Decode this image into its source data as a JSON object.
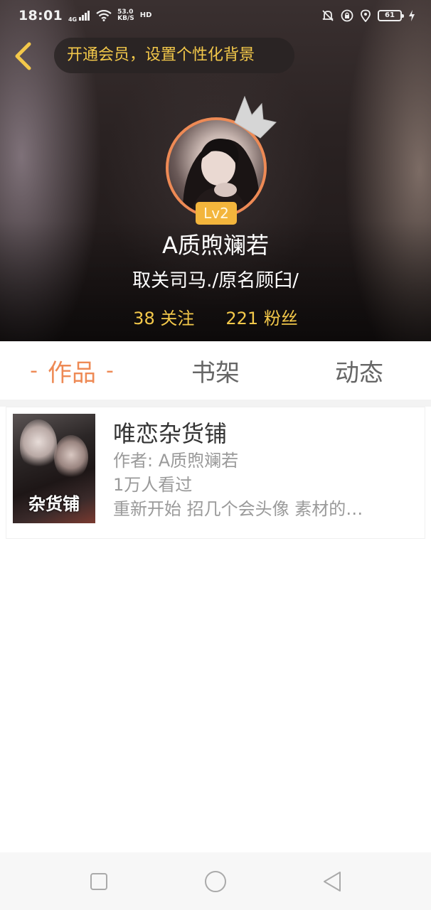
{
  "status_bar": {
    "time": "18:01",
    "network": "4G",
    "net_speed_value": "53.0",
    "net_speed_unit": "KB/S",
    "hd": "HD",
    "battery": "61"
  },
  "header": {
    "vip_banner": "开通会员，设置个性化背景",
    "level": "Lv2",
    "username": "A质煦斓若",
    "signature": "取关司马./原名顾臼/",
    "following_count": "38",
    "following_label": "关注",
    "followers_count": "221",
    "followers_label": "粉丝"
  },
  "tabs": [
    {
      "label": "作品",
      "active": true
    },
    {
      "label": "书架",
      "active": false
    },
    {
      "label": "动态",
      "active": false
    }
  ],
  "works": [
    {
      "title": "唯恋杂货铺",
      "author": "作者: A质煦斓若",
      "views": "1万人看过",
      "summary": "重新开始 招几个会头像 素材的…",
      "cover_text": "杂货铺"
    }
  ],
  "colors": {
    "accent": "#ee8a55",
    "gold": "#f3c84a",
    "level_badge": "#f3b53c"
  },
  "icons": [
    "back-chevron-icon",
    "crown-icon",
    "signal-icon",
    "wifi-icon",
    "mute-bell-icon",
    "lock-rotate-icon",
    "location-icon",
    "battery-icon",
    "charging-icon",
    "nav-recent-icon",
    "nav-home-icon",
    "nav-back-icon"
  ]
}
